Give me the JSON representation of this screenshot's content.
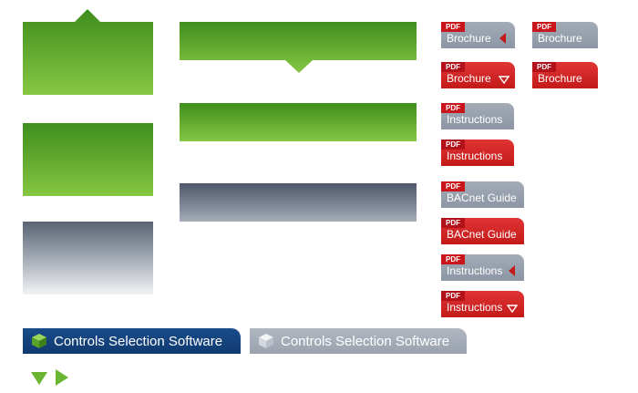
{
  "pdf_tag": "PDF",
  "buttons": {
    "brochure_gray_left": {
      "label": "Brochure",
      "arrow": "left-arrow-icon"
    },
    "brochure_gray_plain": {
      "label": "Brochure"
    },
    "brochure_red_down": {
      "label": "Brochure",
      "arrow": "down-arrow-icon"
    },
    "brochure_red_plain": {
      "label": "Brochure"
    },
    "instructions_gray": {
      "label": "Instructions"
    },
    "instructions_red": {
      "label": "Instructions"
    },
    "bacnet_gray": {
      "label": "BACnet Guide"
    },
    "bacnet_red": {
      "label": "BACnet Guide"
    },
    "instructions_gray_left": {
      "label": "Instructions",
      "arrow": "left-arrow-icon"
    },
    "instructions_red_down": {
      "label": "Instructions",
      "arrow": "down-arrow-icon"
    }
  },
  "tabs": {
    "active": {
      "label": "Controls Selection Software",
      "icon": "cube-icon"
    },
    "inactive": {
      "label": "Controls Selection Software",
      "icon": "cube-icon"
    }
  },
  "colors": {
    "green": "#62a92f",
    "gray": "#7b8595",
    "red": "#c41a1a",
    "navy": "#0f3a70"
  }
}
